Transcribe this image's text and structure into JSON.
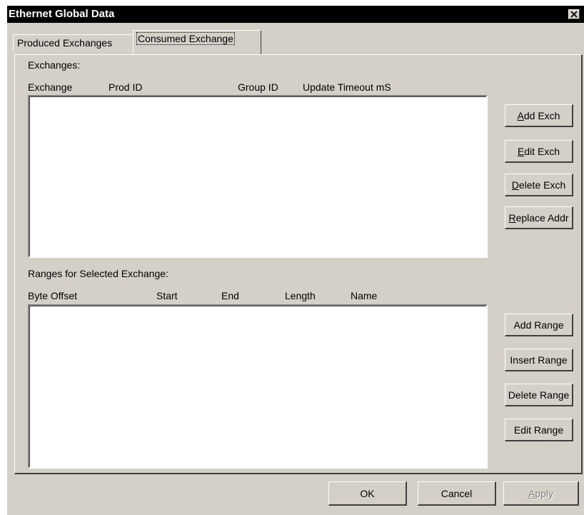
{
  "window": {
    "title": "Ethernet Global Data"
  },
  "tabs": [
    {
      "label": "Produced Exchanges"
    },
    {
      "label": "Consumed Exchange"
    }
  ],
  "exchanges": {
    "section_label": "Exchanges:",
    "columns": [
      "Exchange",
      "Prod ID",
      "Group ID",
      "Update Timeout mS"
    ],
    "rows": []
  },
  "exchange_buttons": {
    "add": {
      "mnemonic": "A",
      "rest": "dd Exch"
    },
    "edit": {
      "mnemonic": "E",
      "rest": "dit Exch"
    },
    "delete": {
      "mnemonic": "D",
      "rest": "elete Exch"
    },
    "replace": {
      "mnemonic": "R",
      "rest": "eplace Addr"
    }
  },
  "ranges": {
    "section_label": "Ranges for Selected Exchange:",
    "columns": [
      "Byte Offset",
      "Start",
      "End",
      "Length",
      "Name"
    ],
    "rows": []
  },
  "range_buttons": {
    "add": "Add Range",
    "insert": "Insert Range",
    "delete": "Delete Range",
    "edit": "Edit Range"
  },
  "footer_buttons": {
    "ok": "OK",
    "cancel": "Cancel",
    "apply_mnemonic": "A",
    "apply_rest": "pply"
  },
  "colors": {
    "face": "#d4d0c8",
    "titlebar": "#000000",
    "disabled_text": "#808080"
  }
}
